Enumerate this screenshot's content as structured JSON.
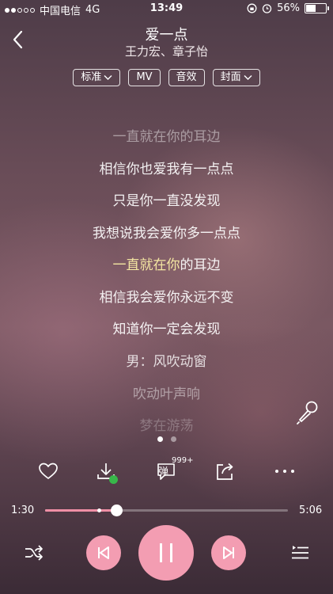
{
  "status": {
    "carrier": "中国电信",
    "network": "4G",
    "time": "13:49",
    "battery": "56%",
    "battery_level": 0.56
  },
  "song": {
    "title": "爱一点",
    "artists": "王力宏、章子怡"
  },
  "chips": [
    "标准",
    "MV",
    "音效",
    "封面"
  ],
  "lyrics": {
    "lines": [
      "一直就在你的耳边",
      "相信你也爱我有一点点",
      "只是你一直没发现",
      "我想说我会爱你多一点点",
      "一直就在你的耳边",
      "相信我会爱你永远不变",
      "知道你一定会发现",
      "男：风吹动窗",
      "吹动叶声响",
      "梦在游荡"
    ],
    "current_sung": "一直就在你",
    "current_rest": "的耳边"
  },
  "comment_count": "999+",
  "comment_label": "弹",
  "progress": {
    "elapsed": "1:30",
    "total": "5:06",
    "played_fraction": 0.294,
    "buffer_marker_fraction": 0.22
  },
  "colors": {
    "accent": "#f39db2",
    "progress": "#ef8fa5",
    "highlight": "#f4e6a2"
  },
  "icons": {
    "back": "chevron-left-icon",
    "mic": "microphone-icon",
    "like": "heart-icon",
    "download": "download-icon",
    "comment": "comment-bubble-icon",
    "share": "share-icon",
    "more": "more-dots-icon",
    "shuffle": "shuffle-icon",
    "prev": "skip-previous-icon",
    "pause": "pause-icon",
    "next": "skip-next-icon",
    "queue": "playlist-icon"
  }
}
